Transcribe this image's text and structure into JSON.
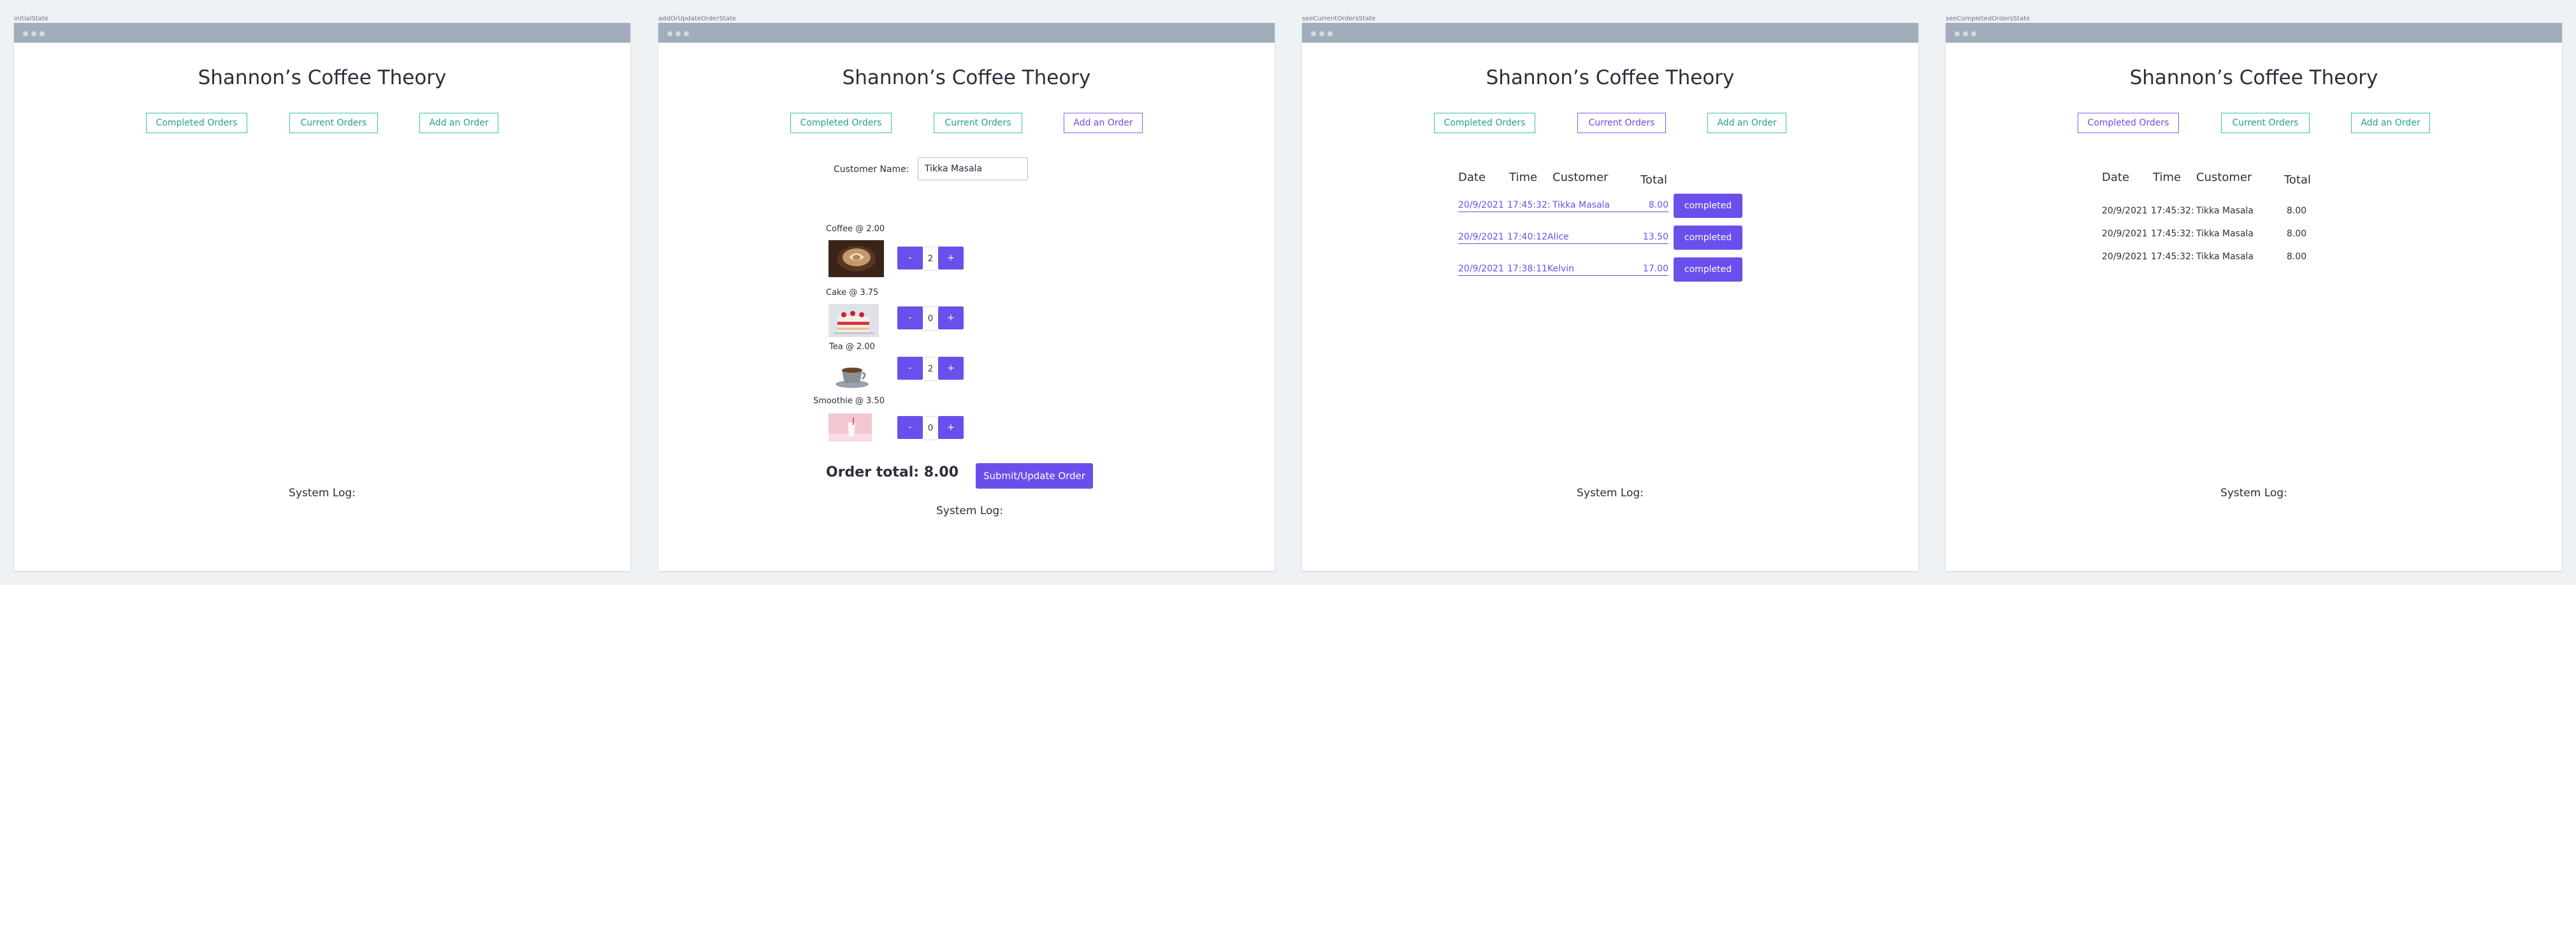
{
  "app_title": "Shannon’s Coffee Theory",
  "nav": {
    "completed": "Completed Orders",
    "current": "Current Orders",
    "add": "Add an Order"
  },
  "system_log": "System Log:",
  "states": {
    "initial": "initialState",
    "add_update": "addOrUpdateOrderState",
    "current": "seeCurrentOrdersState",
    "completed": "seeCompletedOrdersState"
  },
  "form": {
    "customer_label": "Customer Name:",
    "customer_value": "Tikka Masala",
    "items": [
      {
        "label": "Coffee @ 2.00",
        "qty": "2",
        "image": "coffee-image"
      },
      {
        "label": "Cake @ 3.75",
        "qty": "0",
        "image": "cake-image"
      },
      {
        "label": "Tea @ 2.00",
        "qty": "2",
        "image": "tea-image"
      },
      {
        "label": "Smoothie @ 3.50",
        "qty": "0",
        "image": "smoothie-image"
      }
    ],
    "minus": "-",
    "plus": "+",
    "order_total": "Order total: 8.00",
    "submit": "Submit/Update Order"
  },
  "table_headers": {
    "date": "Date",
    "time": "Time",
    "customer": "Customer",
    "total": "Total"
  },
  "current_orders": [
    {
      "date": "20/9/2021",
      "time": "17:45:32:",
      "customer": "Tikka Masala",
      "total": "8.00"
    },
    {
      "date": "20/9/2021",
      "time": "17:40:12",
      "customer": "Alice",
      "total": "13.50"
    },
    {
      "date": "20/9/2021",
      "time": "17:38:11",
      "customer": "Kelvin",
      "total": "17.00"
    }
  ],
  "complete_button": "completed",
  "completed_orders": [
    {
      "date": "20/9/2021",
      "time": "17:45:32:",
      "customer": "Tikka Masala",
      "total": "8.00"
    },
    {
      "date": "20/9/2021",
      "time": "17:45:32:",
      "customer": "Tikka Masala",
      "total": "8.00"
    },
    {
      "date": "20/9/2021",
      "time": "17:45:32:",
      "customer": "Tikka Masala",
      "total": "8.00"
    }
  ],
  "colors": {
    "accent": "#6a4fec",
    "nav_green": "#1fa387",
    "titlebar": "#a0adbb",
    "canvas": "#eff2f5"
  }
}
